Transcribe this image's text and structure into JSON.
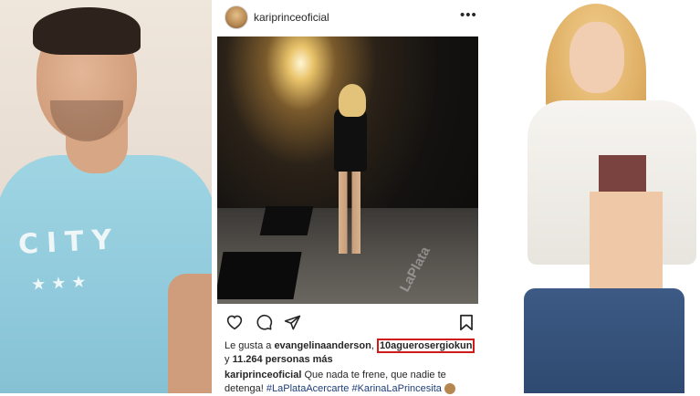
{
  "left_photo": {
    "shirt_text": "CITY",
    "shirt_stars": "★★★"
  },
  "post": {
    "username": "kariprinceoficial",
    "more_icon": "more-horizontal-icon",
    "image_logo_text": "LaPlata",
    "actions": {
      "icons": [
        "heart-icon",
        "comment-icon",
        "share-icon",
        "bookmark-icon"
      ]
    },
    "likes": {
      "prefix": "Le gusta a",
      "user1": "evangelinaanderson",
      "separator": ",",
      "user2": "10aguerosergiokun",
      "suffix_prefix": "y",
      "count_text": "11.264 personas más"
    },
    "caption": {
      "username": "kariprinceoficial",
      "text": "Que nada te frene, que nadie te detenga!",
      "hashtag1": "#LaPlataAcercarte",
      "hashtag2": "#KarinaLaPrincesita"
    },
    "highlight_color": "#d11a1a"
  }
}
